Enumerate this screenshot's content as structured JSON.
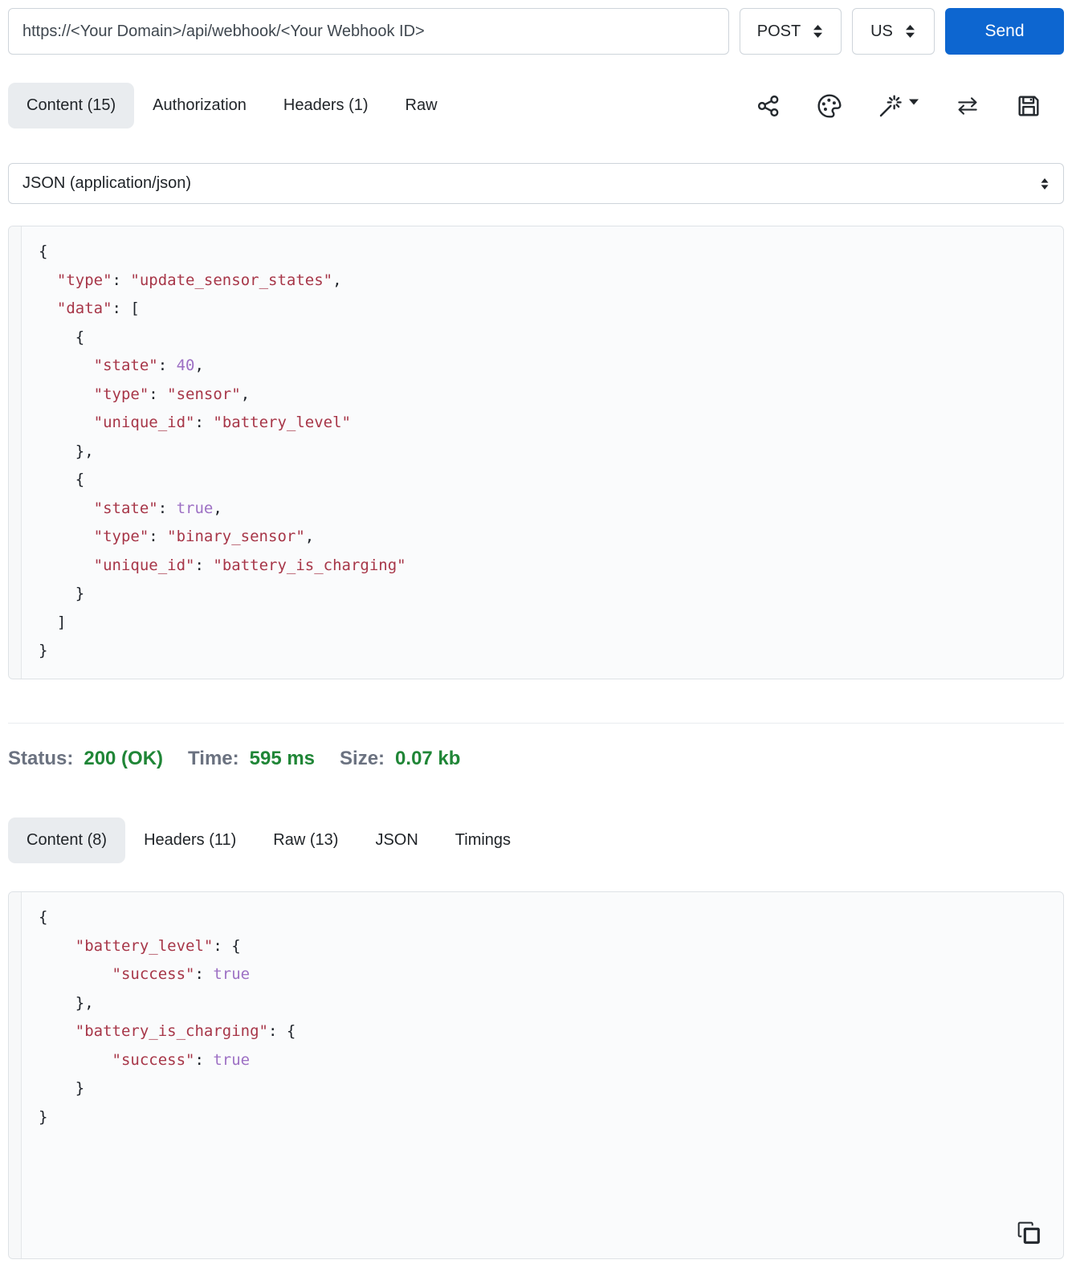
{
  "colors": {
    "accent_blue": "#0d66d0",
    "active_tab_bg": "#e9ecef",
    "status_green": "#208637",
    "label_gray": "#6b7280",
    "code_string": "#a73648",
    "code_number": "#9d70c4",
    "code_punctuation": "#1c2128"
  },
  "request_bar": {
    "url_value": "https://<Your Domain>/api/webhook/<Your Webhook ID>",
    "method": "POST",
    "region": "US",
    "send_label": "Send"
  },
  "request_tabs": [
    {
      "id": "content",
      "label": "Content (15)",
      "active": true
    },
    {
      "id": "authorization",
      "label": "Authorization",
      "active": false
    },
    {
      "id": "headers",
      "label": "Headers (1)",
      "active": false
    },
    {
      "id": "raw",
      "label": "Raw",
      "active": false
    }
  ],
  "toolbar": {
    "icons": [
      "share-icon",
      "palette-icon",
      "magic-wand-icon",
      "swap-arrows-icon",
      "save-icon"
    ]
  },
  "body_type": {
    "value": "JSON (application/json)"
  },
  "request_body_lines": [
    [
      [
        "p",
        "{"
      ]
    ],
    [
      [
        "p",
        "  "
      ],
      [
        "s",
        "\"type\""
      ],
      [
        "p",
        ": "
      ],
      [
        "s",
        "\"update_sensor_states\""
      ],
      [
        "p",
        ","
      ]
    ],
    [
      [
        "p",
        "  "
      ],
      [
        "s",
        "\"data\""
      ],
      [
        "p",
        ": ["
      ]
    ],
    [
      [
        "p",
        "    {"
      ]
    ],
    [
      [
        "p",
        "      "
      ],
      [
        "s",
        "\"state\""
      ],
      [
        "p",
        ": "
      ],
      [
        "n",
        "40"
      ],
      [
        "p",
        ","
      ]
    ],
    [
      [
        "p",
        "      "
      ],
      [
        "s",
        "\"type\""
      ],
      [
        "p",
        ": "
      ],
      [
        "s",
        "\"sensor\""
      ],
      [
        "p",
        ","
      ]
    ],
    [
      [
        "p",
        "      "
      ],
      [
        "s",
        "\"unique_id\""
      ],
      [
        "p",
        ": "
      ],
      [
        "s",
        "\"battery_level\""
      ]
    ],
    [
      [
        "p",
        "    },"
      ]
    ],
    [
      [
        "p",
        "    {"
      ]
    ],
    [
      [
        "p",
        "      "
      ],
      [
        "s",
        "\"state\""
      ],
      [
        "p",
        ": "
      ],
      [
        "n",
        "true"
      ],
      [
        "p",
        ","
      ]
    ],
    [
      [
        "p",
        "      "
      ],
      [
        "s",
        "\"type\""
      ],
      [
        "p",
        ": "
      ],
      [
        "s",
        "\"binary_sensor\""
      ],
      [
        "p",
        ","
      ]
    ],
    [
      [
        "p",
        "      "
      ],
      [
        "s",
        "\"unique_id\""
      ],
      [
        "p",
        ": "
      ],
      [
        "s",
        "\"battery_is_charging\""
      ]
    ],
    [
      [
        "p",
        "    }"
      ]
    ],
    [
      [
        "p",
        "  ]"
      ]
    ],
    [
      [
        "p",
        "}"
      ]
    ]
  ],
  "response": {
    "status_label": "Status:",
    "status_value": "200 (OK)",
    "time_label": "Time:",
    "time_value": "595 ms",
    "size_label": "Size:",
    "size_value": "0.07 kb",
    "tabs": [
      {
        "id": "content",
        "label": "Content (8)",
        "active": true
      },
      {
        "id": "headers",
        "label": "Headers (11)",
        "active": false
      },
      {
        "id": "raw",
        "label": "Raw (13)",
        "active": false
      },
      {
        "id": "json",
        "label": "JSON",
        "active": false
      },
      {
        "id": "timings",
        "label": "Timings",
        "active": false
      }
    ],
    "body_lines": [
      [
        [
          "p",
          "{"
        ]
      ],
      [
        [
          "p",
          "    "
        ],
        [
          "s",
          "\"battery_level\""
        ],
        [
          "p",
          ": {"
        ]
      ],
      [
        [
          "p",
          "        "
        ],
        [
          "s",
          "\"success\""
        ],
        [
          "p",
          ": "
        ],
        [
          "n",
          "true"
        ]
      ],
      [
        [
          "p",
          "    },"
        ]
      ],
      [
        [
          "p",
          "    "
        ],
        [
          "s",
          "\"battery_is_charging\""
        ],
        [
          "p",
          ": {"
        ]
      ],
      [
        [
          "p",
          "        "
        ],
        [
          "s",
          "\"success\""
        ],
        [
          "p",
          ": "
        ],
        [
          "n",
          "true"
        ]
      ],
      [
        [
          "p",
          "    }"
        ]
      ],
      [
        [
          "p",
          "}"
        ]
      ]
    ],
    "copy_icon": "copy-icon"
  }
}
